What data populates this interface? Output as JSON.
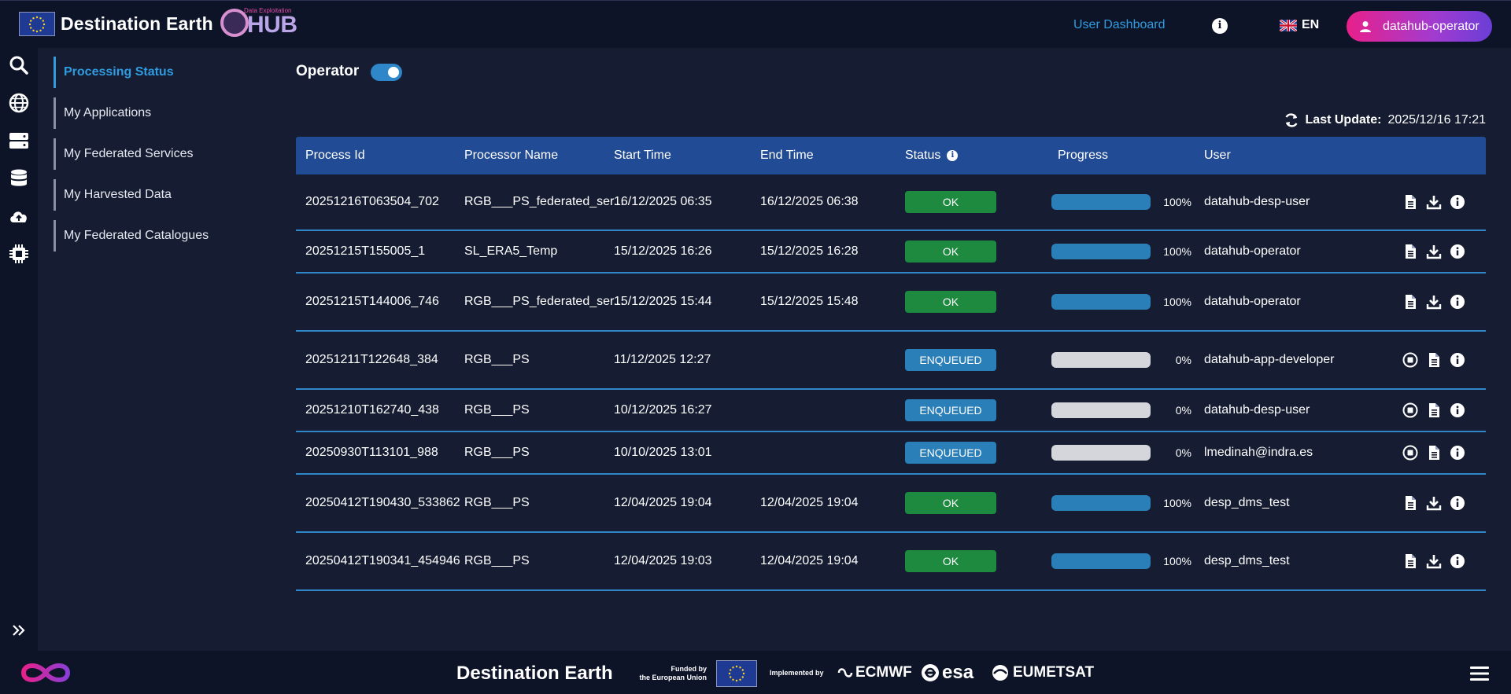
{
  "header": {
    "brand": "Destination Earth",
    "hub_subtitle": "Data Exploitation",
    "hub_name": "HUB",
    "nav_link": "User Dashboard",
    "language": "EN",
    "user": "datahub-operator"
  },
  "sidebar": {
    "items": [
      {
        "label": "Processing Status",
        "active": true
      },
      {
        "label": "My Applications"
      },
      {
        "label": "My Federated Services"
      },
      {
        "label": "My Harvested Data"
      },
      {
        "label": "My Federated Catalogues"
      }
    ]
  },
  "main": {
    "operator_label": "Operator",
    "operator_enabled": true,
    "last_update_label": "Last Update:",
    "last_update_value": "2025/12/16 17:21"
  },
  "table": {
    "columns": [
      "Process Id",
      "Processor Name",
      "Start Time",
      "End Time",
      "Status",
      "Progress",
      "User"
    ],
    "rows": [
      {
        "id": "20251216T063504_702",
        "processor": "RGB___PS_federated_ser...",
        "start": "16/12/2025 06:35",
        "end": "16/12/2025 06:38",
        "status": "OK",
        "progress": 100,
        "progress_label": "100%",
        "user": "datahub-desp-user",
        "actions": [
          "file",
          "download",
          "info"
        ]
      },
      {
        "id": "20251215T155005_1",
        "processor": "SL_ERA5_Temp",
        "start": "15/12/2025 16:26",
        "end": "15/12/2025 16:28",
        "status": "OK",
        "progress": 100,
        "progress_label": "100%",
        "user": "datahub-operator",
        "actions": [
          "file",
          "download",
          "info"
        ]
      },
      {
        "id": "20251215T144006_746",
        "processor": "RGB___PS_federated_ser...",
        "start": "15/12/2025 15:44",
        "end": "15/12/2025 15:48",
        "status": "OK",
        "progress": 100,
        "progress_label": "100%",
        "user": "datahub-operator",
        "actions": [
          "file",
          "download",
          "info"
        ]
      },
      {
        "id": "20251211T122648_384",
        "processor": "RGB___PS",
        "start": "11/12/2025 12:27",
        "end": "",
        "status": "ENQUEUED",
        "progress": 0,
        "progress_label": "0%",
        "user": "datahub-app-developer",
        "actions": [
          "stop",
          "file",
          "info"
        ]
      },
      {
        "id": "20251210T162740_438",
        "processor": "RGB___PS",
        "start": "10/12/2025 16:27",
        "end": "",
        "status": "ENQUEUED",
        "progress": 0,
        "progress_label": "0%",
        "user": "datahub-desp-user",
        "actions": [
          "stop",
          "file",
          "info"
        ]
      },
      {
        "id": "20250930T113101_988",
        "processor": "RGB___PS",
        "start": "10/10/2025 13:01",
        "end": "",
        "status": "ENQUEUED",
        "progress": 0,
        "progress_label": "0%",
        "user": "lmedinah@indra.es",
        "actions": [
          "stop",
          "file",
          "info"
        ]
      },
      {
        "id": "20250412T190430_533862",
        "processor": "RGB___PS",
        "start": "12/04/2025 19:04",
        "end": "12/04/2025 19:04",
        "status": "OK",
        "progress": 100,
        "progress_label": "100%",
        "user": "desp_dms_test",
        "actions": [
          "file",
          "download",
          "info"
        ]
      },
      {
        "id": "20250412T190341_454946",
        "processor": "RGB___PS",
        "start": "12/04/2025 19:03",
        "end": "12/04/2025 19:04",
        "status": "OK",
        "progress": 100,
        "progress_label": "100%",
        "user": "desp_dms_test",
        "actions": [
          "file",
          "download",
          "info"
        ]
      }
    ]
  },
  "footer": {
    "brand": "Destination Earth",
    "funded_line1": "Funded by",
    "funded_line2": "the European Union",
    "implemented_by": "Implemented by",
    "partner_1": "ECMWF",
    "partner_2": "esa",
    "partner_3": "EUMETSAT"
  },
  "colors": {
    "accent": "#2f9ce0",
    "ok": "#1d8a3f",
    "enqueued": "#2a7fb8",
    "table_header": "#214b94",
    "user_gradient_start": "#e8208a",
    "user_gradient_end": "#6a3ed6"
  }
}
